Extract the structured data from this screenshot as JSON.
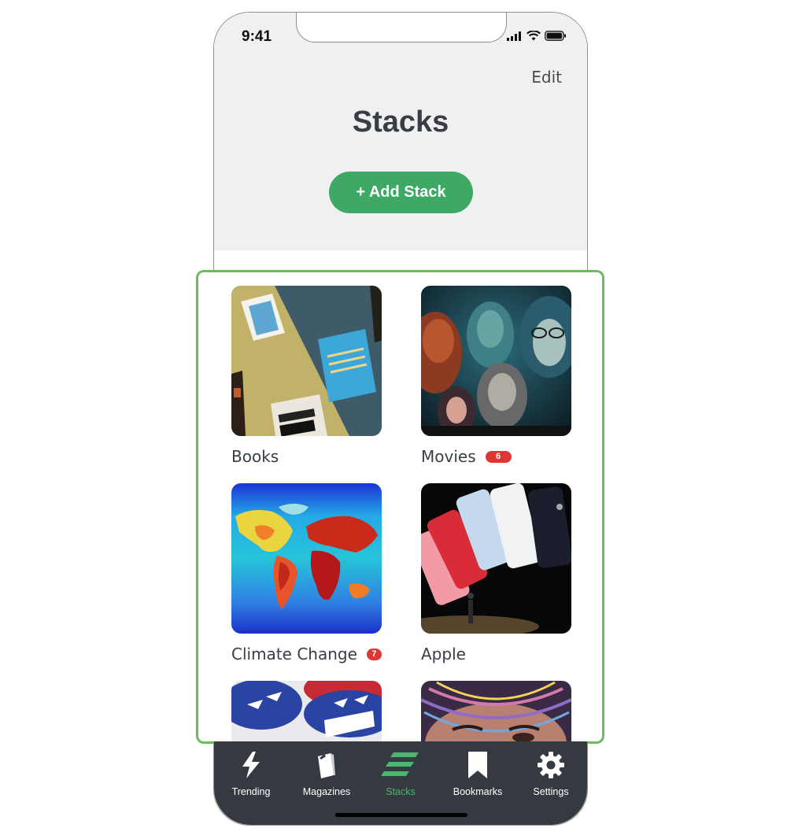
{
  "status": {
    "time": "9:41"
  },
  "header": {
    "edit_label": "Edit",
    "title": "Stacks",
    "add_button_label": "+ Add Stack"
  },
  "stacks": [
    {
      "label": "Books",
      "image": "books-cover-image",
      "badge": ""
    },
    {
      "label": "Movies",
      "image": "movies-poster-image",
      "badge": "6"
    },
    {
      "label": "Climate Change",
      "image": "climate-map-image",
      "badge": "7"
    },
    {
      "label": "Apple",
      "image": "iphone-image",
      "badge": ""
    },
    {
      "label": "",
      "image": "vote-buttons-image",
      "badge": ""
    },
    {
      "label": "",
      "image": "colorful-face-image",
      "badge": ""
    }
  ],
  "tabbar": {
    "tabs": [
      {
        "label": "Trending",
        "icon": "lightning-icon",
        "active": false
      },
      {
        "label": "Magazines",
        "icon": "magazine-icon",
        "active": false
      },
      {
        "label": "Stacks",
        "icon": "stacks-icon",
        "active": true
      },
      {
        "label": "Bookmarks",
        "icon": "bookmark-icon",
        "active": false
      },
      {
        "label": "Settings",
        "icon": "gear-icon",
        "active": false
      }
    ]
  },
  "colors": {
    "accent_green": "#3ea965",
    "badge_red": "#dc3733",
    "tabbar_bg": "#353a41",
    "selection_outline": "#6dbb5e"
  }
}
